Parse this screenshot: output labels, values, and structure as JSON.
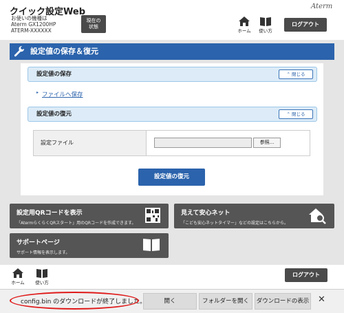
{
  "header": {
    "title": "クイック設定Web",
    "device_line1": "お使いの機種は",
    "device_line2": "Aterm GX1200HP",
    "device_line3": "ATERM-XXXXXX",
    "status_line1": "現在の",
    "status_line2": "状態",
    "brand": "Aterm",
    "home_label": "ホーム",
    "help_label": "使い方",
    "logout_label": "ログアウト"
  },
  "section": {
    "title": "設定値の保存＆復元",
    "save_header": "設定値の保存",
    "close_label": "閉じる",
    "save_link": "ファイルへ保存",
    "restore_header": "設定値の復元",
    "file_label": "設定ファイル",
    "browse_label": "参照...",
    "restore_button": "設定値の復元"
  },
  "tiles": {
    "qr_title": "設定用QRコードを表示",
    "qr_desc": "「AtermらくらくQRスタート」用のQRコードを作成できます。",
    "safe_title": "見えて安心ネット",
    "safe_desc": "「こども安心ネットタイマー」などの設定はこちらから。",
    "support_title": "サポートページ",
    "support_desc": "サポート情報を表示します。"
  },
  "footer": {
    "home_label": "ホーム",
    "help_label": "使い方",
    "logout_label": "ログアウト"
  },
  "download_bar": {
    "message": "config.bin のダウンロードが終了しました。",
    "open_label": "開く",
    "open_folder_label": "フォルダーを開く",
    "show_downloads_label": "ダウンロードの表示",
    "close_label": "✕"
  },
  "colors": {
    "accent": "#2b63ac",
    "tile": "#555555",
    "highlight": "#e01a1a"
  }
}
